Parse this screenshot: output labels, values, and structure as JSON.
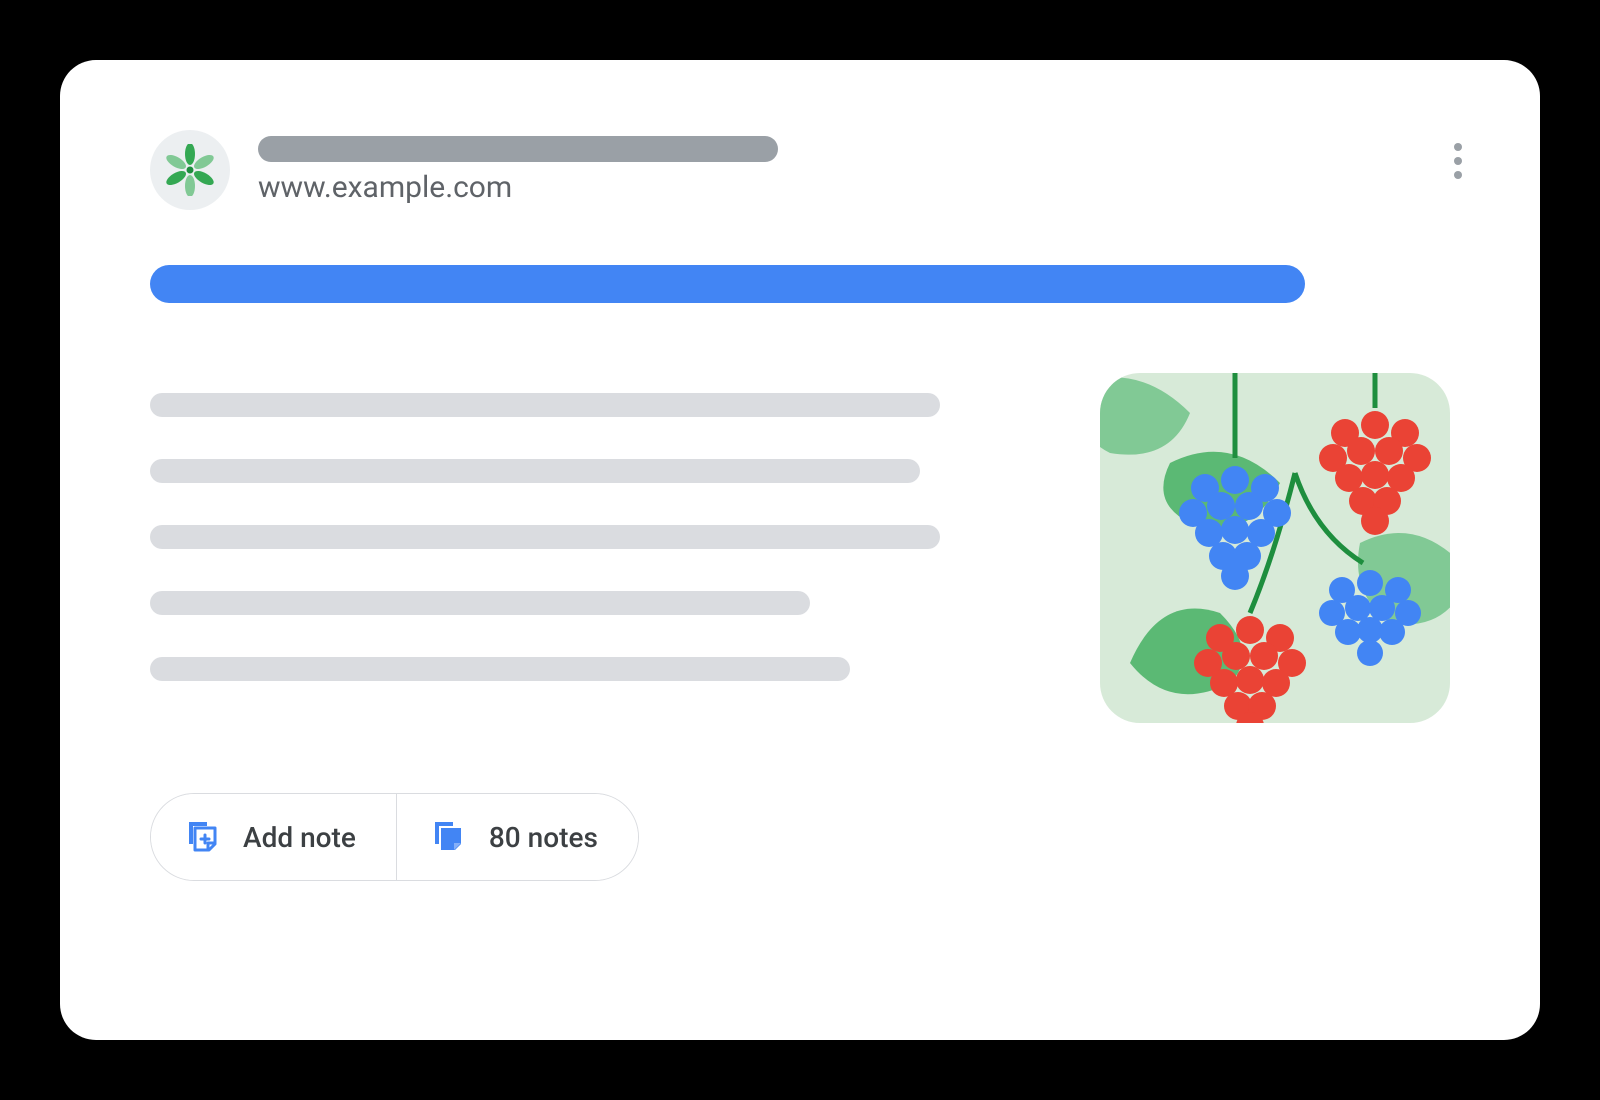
{
  "header": {
    "url": "www.example.com"
  },
  "actions": {
    "add_note_label": "Add note",
    "notes_count_label": "80 notes"
  }
}
